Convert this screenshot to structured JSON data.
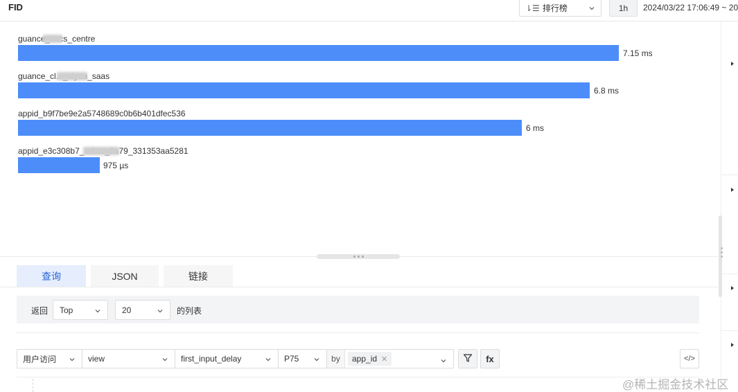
{
  "header": {
    "title": "FID",
    "chart_type": "排行榜",
    "time_range_button": "1h",
    "time_range_text": "2024/03/22 17:06:49 ~ 20"
  },
  "bars": [
    {
      "label": "guance_docs_centre",
      "value_text": "7.15 ms",
      "value_ms": 7.15
    },
    {
      "label": "guance_cl..._..iyun_saas",
      "value_text": "6.8 ms",
      "value_ms": 6.8
    },
    {
      "label": "appid_b9f7be9e2a5748689c0b6b401dfec536",
      "value_text": "6 ms",
      "value_ms": 6
    },
    {
      "label": "appid_e3c308b7_...1ee_8a79_331353aa5281",
      "value_text": "975 µs",
      "value_ms": 0.975
    }
  ],
  "tabs": [
    "查询",
    "JSON",
    "链接"
  ],
  "return_panel": {
    "label": "返回",
    "order": "Top",
    "count": "20",
    "suffix": "的列表"
  },
  "query": {
    "source": "用户访问",
    "dataset": "view",
    "metric": "first_input_delay",
    "aggregation": "P75",
    "by_label": "by",
    "by_tag": "app_id",
    "filter_icon": "filter-icon",
    "fx_label": "fx",
    "code_icon": "</>"
  },
  "watermark": "@稀土掘金技术社区",
  "colors": {
    "bar": "#4c8dfa",
    "active_tab_bg": "#e6eefd",
    "active_tab_text": "#2a64d6"
  }
}
